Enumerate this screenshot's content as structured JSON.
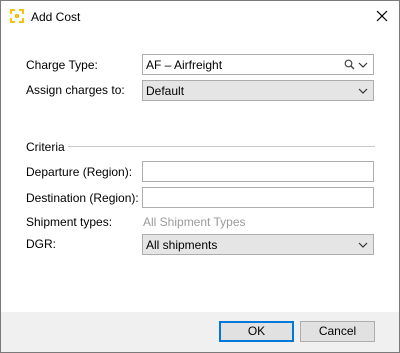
{
  "window": {
    "title": "Add Cost"
  },
  "form": {
    "charge_type": {
      "label": "Charge Type:",
      "value": "AF – Airfreight"
    },
    "assign_charges": {
      "label": "Assign charges to:",
      "value": "Default"
    },
    "criteria": {
      "heading": "Criteria"
    },
    "departure": {
      "label": "Departure (Region):",
      "value": ""
    },
    "destination": {
      "label": "Destination (Region):",
      "value": ""
    },
    "shipment_types": {
      "label": "Shipment types:",
      "value": "All Shipment Types"
    },
    "dgr": {
      "label": "DGR:",
      "value": "All shipments"
    }
  },
  "footer": {
    "ok_label": "OK",
    "cancel_label": "Cancel"
  },
  "colors": {
    "accent": "#0078d7",
    "icon_yellow": "#f2c40f",
    "footer_bg": "#f0f0f0",
    "combo_bg": "#e5e5e5"
  },
  "icons": [
    "app-icon",
    "close-icon",
    "search-icon",
    "chevron-down-icon"
  ]
}
